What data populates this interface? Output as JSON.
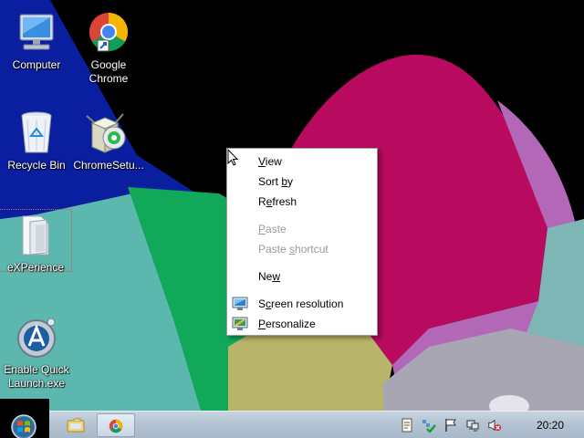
{
  "desktop": {
    "icons": [
      {
        "label": "Computer",
        "icon": "computer-icon"
      },
      {
        "label": "Google\nChrome",
        "icon": "chrome-icon"
      },
      {
        "label": "Recycle Bin",
        "icon": "recycle-bin-icon"
      },
      {
        "label": "ChromeSetu...",
        "icon": "installer-icon"
      },
      {
        "label": "eXPerience",
        "icon": "folder-icon"
      },
      {
        "label": "Enable Quick\nLaunch.exe",
        "icon": "quicklaunch-icon"
      }
    ],
    "selected_icon": "eXPerience"
  },
  "context_menu": {
    "items": [
      {
        "label": "View",
        "mnemonic_index": 0,
        "enabled": true
      },
      {
        "label": "Sort by",
        "mnemonic_index": 5,
        "enabled": true
      },
      {
        "label": "Refresh",
        "mnemonic_index": 1,
        "enabled": true
      },
      {
        "label": "Paste",
        "mnemonic_index": 0,
        "enabled": false
      },
      {
        "label": "Paste shortcut",
        "mnemonic_index": 6,
        "enabled": false
      },
      {
        "label": "New",
        "mnemonic_index": 2,
        "enabled": true
      },
      {
        "label": "Screen resolution",
        "mnemonic_index": 1,
        "enabled": true,
        "icon": "display-icon"
      },
      {
        "label": "Personalize",
        "mnemonic_index": 1,
        "enabled": true,
        "icon": "personalize-icon"
      }
    ]
  },
  "taskbar": {
    "clock": "20:20",
    "pinned": [
      "explorer-icon",
      "chrome-icon"
    ],
    "tray_icons": [
      "notes-icon",
      "network-check-icon",
      "flag-icon",
      "network-icon",
      "volume-muted-icon"
    ]
  },
  "colors": {
    "taskbar": "#b4c4d4",
    "menu_disabled_text": "#9b9b9b"
  }
}
